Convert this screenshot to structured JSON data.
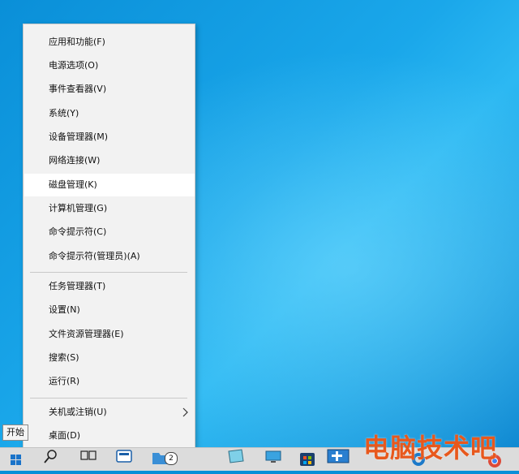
{
  "menu": {
    "items": [
      {
        "label": "应用和功能(F)"
      },
      {
        "label": "电源选项(O)"
      },
      {
        "label": "事件查看器(V)"
      },
      {
        "label": "系统(Y)"
      },
      {
        "label": "设备管理器(M)"
      },
      {
        "label": "网络连接(W)"
      },
      {
        "label": "磁盘管理(K)"
      },
      {
        "label": "计算机管理(G)"
      },
      {
        "label": "命令提示符(C)"
      },
      {
        "label": "命令提示符(管理员)(A)"
      },
      {
        "label": "任务管理器(T)"
      },
      {
        "label": "设置(N)"
      },
      {
        "label": "文件资源管理器(E)"
      },
      {
        "label": "搜索(S)"
      },
      {
        "label": "运行(R)"
      },
      {
        "label": "关机或注销(U)"
      },
      {
        "label": "桌面(D)"
      }
    ]
  },
  "tooltip": {
    "start": "开始"
  },
  "taskbar": {
    "badge_count": "2"
  },
  "watermark": {
    "text": "电脑技术吧"
  },
  "colors": {
    "desktop": "#0a8fd8",
    "menu_bg": "#f2f2f2",
    "taskbar_bg": "#dcdcdc",
    "watermark": "#e8581c"
  },
  "icons": [
    "windows-start-icon",
    "search-icon",
    "task-view-icon",
    "calendar-app-icon",
    "file-explorer-icon",
    "notepad-icon",
    "network-icon",
    "store-icon",
    "remote-desktop-icon",
    "edge-icon",
    "chrome-icon"
  ]
}
